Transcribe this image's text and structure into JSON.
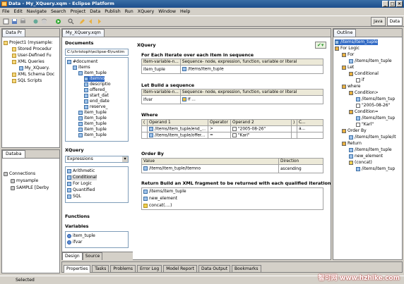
{
  "window": {
    "title": "Data - My_XQuery.xqm - Eclipse Platform"
  },
  "menu": [
    "File",
    "Edit",
    "Navigate",
    "Search",
    "Project",
    "Data",
    "Publish",
    "Run",
    "XQuery",
    "Window",
    "Help"
  ],
  "perspectives": [
    "Java",
    "Data"
  ],
  "data_project": {
    "tab": "Data Pr",
    "tree": [
      "Project1 (mysample:",
      "Stored Procedur",
      "User-Defined Fu",
      "XML Queries",
      "My_XQuery.",
      "XML Schema Doc",
      "SQL Scripts"
    ]
  },
  "database": {
    "tab": "Databa",
    "tree": [
      "Connections",
      "mysample",
      "SAMPLE [Derby"
    ]
  },
  "editor": {
    "tab": "My_XQuery.xqm",
    "documents_label": "Documents",
    "doc_path": "C:\\christoph\\eclipse-6\\runtim",
    "doc_tree": [
      "#document",
      "items",
      "item_tuple",
      "itemno",
      "descriptio",
      "offered_",
      "start_dat",
      "end_date",
      "reserve_",
      "item_tuple",
      "item_tuple",
      "item_tuple",
      "item_tuple",
      "item_tuple"
    ],
    "xquery_label": "XQuery",
    "dropdown": "Expressions",
    "expressions": [
      "Arithmetic",
      "Conditional",
      "For Logic",
      "Quantified",
      "SQL"
    ],
    "functions_label": "Functions",
    "variables_label": "Variables",
    "variables": [
      "item_tuple",
      "ifvar"
    ],
    "bottom_tabs": [
      "Design",
      "Source"
    ],
    "panel_title": "XQuery",
    "for_section": {
      "title": "For Each Iterate over each item in sequence",
      "headers": [
        "Item-variable-n...",
        "Sequence- node, expression, function, variable or literal"
      ],
      "rows": [
        [
          "item_tuple",
          "/items/item_tuple"
        ]
      ]
    },
    "let_section": {
      "title": "Let Build a sequence",
      "headers": [
        "Item-variable-n...",
        "Sequence- node, expression, function, variable or literal"
      ],
      "rows": [
        [
          "ifvar",
          "if ..."
        ]
      ]
    },
    "where_section": {
      "title": "Where",
      "headers": [
        "(",
        "Operand 1",
        "Operator",
        "Operand 2",
        ")",
        "C..."
      ],
      "rows": [
        [
          "",
          "/items/item_tuple/end_...",
          ">",
          "\"2005-08-26\"",
          "",
          "a..."
        ],
        [
          "",
          "/items/item_tuple/offer...",
          "=",
          "\"Karl\"",
          "",
          ""
        ]
      ]
    },
    "order_section": {
      "title": "Order By",
      "headers": [
        "Value",
        "Direction"
      ],
      "rows": [
        [
          "/items/item_tuple/itemno",
          "ascending"
        ]
      ]
    },
    "return_section": {
      "title": "Return Build an XML  fragment to be returned with each qualified iteration",
      "items": [
        "/items/item_tuple",
        "new_element",
        "concat(....)"
      ]
    }
  },
  "outline": {
    "tab": "Outline",
    "tree": [
      "/items/item_tuple",
      "For Logic",
      "For",
      "/items/item_tuple",
      "Let",
      "Conditional",
      "if",
      "where",
      "Condition>",
      "/items/item_tup",
      "\"2005-08-26\"",
      "Condition=",
      "/items/item_tup",
      "\"Karl\"",
      "Order By",
      "/items/item_tuple/it",
      "Return",
      "/items/item_tuple",
      "new_element",
      "(concat)",
      "/items/item_tup"
    ]
  },
  "bottom_views": [
    "Properties",
    "Tasks",
    "Problems",
    "Error Log",
    "Model Report",
    "Data Output",
    "Bookmarks"
  ],
  "status_text": "Selected",
  "watermark": "智可网 www.hzhike.com"
}
